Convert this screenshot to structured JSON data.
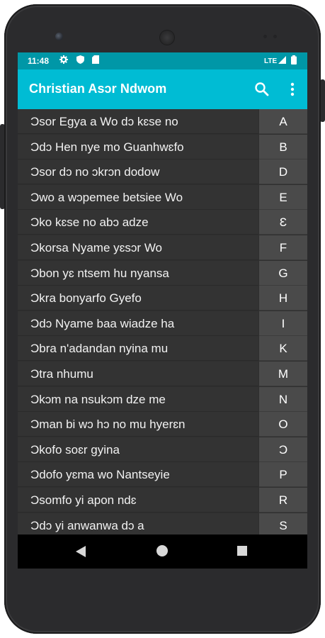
{
  "status_bar": {
    "time": "11:48",
    "left_icons": [
      "gear-icon",
      "shield-icon",
      "sd-card-icon"
    ],
    "network": "LTE",
    "right_icons": [
      "signal-icon",
      "battery-icon"
    ]
  },
  "app_bar": {
    "title": "Christian Asɔr Ndwom",
    "actions": [
      "search-icon",
      "more-vert-icon"
    ],
    "color": "#00bcd4",
    "status_color": "#0097a7"
  },
  "songs": [
    {
      "title": "Ɔsor Egya a Wo dɔ kɛse no",
      "letter": "A"
    },
    {
      "title": "Ɔdɔ Hen nye mo Guanhwɛfo",
      "letter": "B"
    },
    {
      "title": "Ɔsor dɔ no ɔkrɔn dodow",
      "letter": "D"
    },
    {
      "title": "Ɔwo a wɔpemee betsiee Wo",
      "letter": "E"
    },
    {
      "title": "Ɔko kɛse no abɔ adze",
      "letter": "Ɛ"
    },
    {
      "title": "Ɔkorsa Nyame yɛsɔr Wo",
      "letter": "F"
    },
    {
      "title": "Ɔbon yɛ ntsem hu nyansa",
      "letter": "G"
    },
    {
      "title": "Ɔkra bonyarfo Gyefo",
      "letter": "H"
    },
    {
      "title": "Ɔdɔ Nyame baa wiadze ha",
      "letter": "I"
    },
    {
      "title": "Ɔbra n'adandan nyina mu",
      "letter": "K"
    },
    {
      "title": "Ɔtra nhumu",
      "letter": "M"
    },
    {
      "title": "Ɔkɔm na nsukɔm dze me",
      "letter": "N"
    },
    {
      "title": "Ɔman bi wɔ hɔ no mu hyerɛn",
      "letter": "O"
    },
    {
      "title": "Ɔkofo soɛr gyina",
      "letter": "Ɔ"
    },
    {
      "title": "Ɔdofo yɛma wo Nantseyie",
      "letter": "P"
    },
    {
      "title": "Ɔsomfo yi apon ndɛ",
      "letter": "R"
    },
    {
      "title": "Ɔdɔ yi anwanwa dɔ a",
      "letter": "S"
    }
  ],
  "nav_bar": {
    "buttons": [
      "back-icon",
      "home-icon",
      "recents-icon"
    ]
  }
}
